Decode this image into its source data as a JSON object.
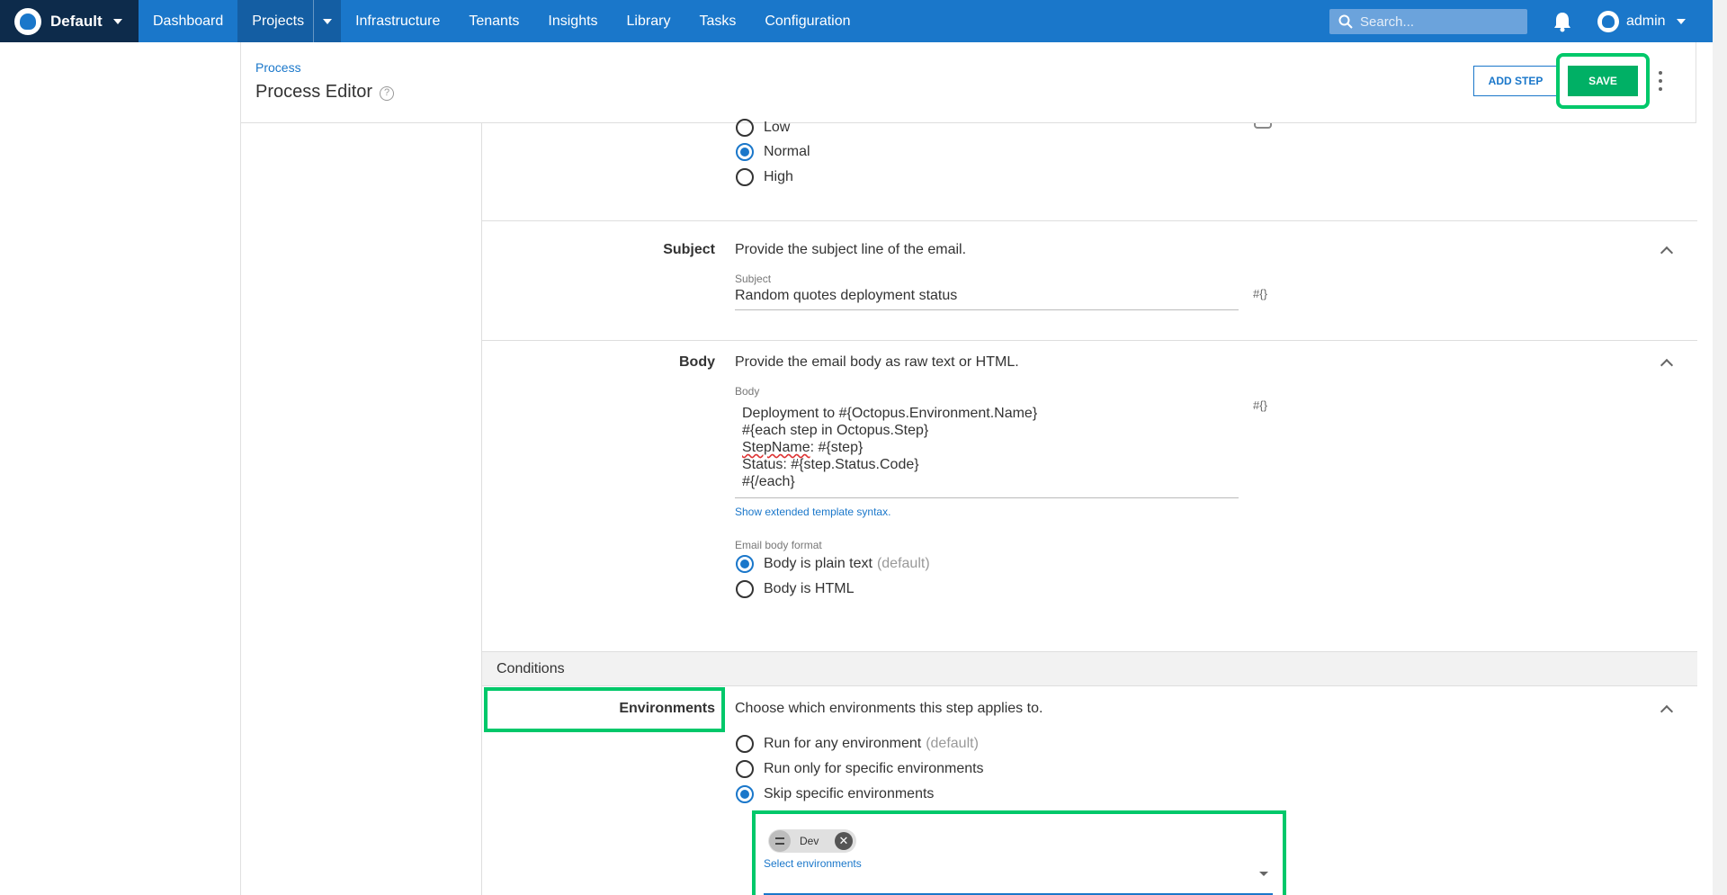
{
  "topbar": {
    "space_name": "Default",
    "nav": [
      "Dashboard",
      "Projects",
      "Infrastructure",
      "Tenants",
      "Insights",
      "Library",
      "Tasks",
      "Configuration"
    ],
    "search_placeholder": "Search...",
    "user_name": "admin",
    "brand_color": "#1a77ca"
  },
  "header": {
    "breadcrumb": "Process",
    "title": "Process Editor",
    "add_step_label": "ADD STEP",
    "save_label": "SAVE"
  },
  "priority": {
    "options": [
      "Low",
      "Normal",
      "High"
    ],
    "selected": "Normal"
  },
  "subject": {
    "label": "Subject",
    "description": "Provide the subject line of the email.",
    "field_label": "Subject",
    "value": "Random quotes deployment status"
  },
  "body": {
    "label": "Body",
    "description": "Provide the email body as raw text or HTML.",
    "field_label": "Body",
    "lines": [
      "Deployment to #{Octopus.Environment.Name}",
      "#{each step in Octopus.Step}",
      "StepName",
      ": #{step}",
      "Status: #{step.Status.Code}",
      "#{/each}"
    ],
    "extended_link": "Show extended template syntax.",
    "format_label": "Email body format",
    "format_option_plain": "Body is plain text",
    "format_option_plain_suffix": "(default)",
    "format_option_html": "Body is HTML"
  },
  "variable_icon": "#{}",
  "conditions": {
    "title": "Conditions",
    "env_label": "Environments",
    "env_description": "Choose which environments this step applies to.",
    "option_any": "Run for any environment",
    "option_any_suffix": "(default)",
    "option_specific": "Run only for specific environments",
    "option_skip": "Skip specific environments",
    "chip": "Dev",
    "select_label": "Select environments"
  },
  "highlight_color": "#00c86a"
}
